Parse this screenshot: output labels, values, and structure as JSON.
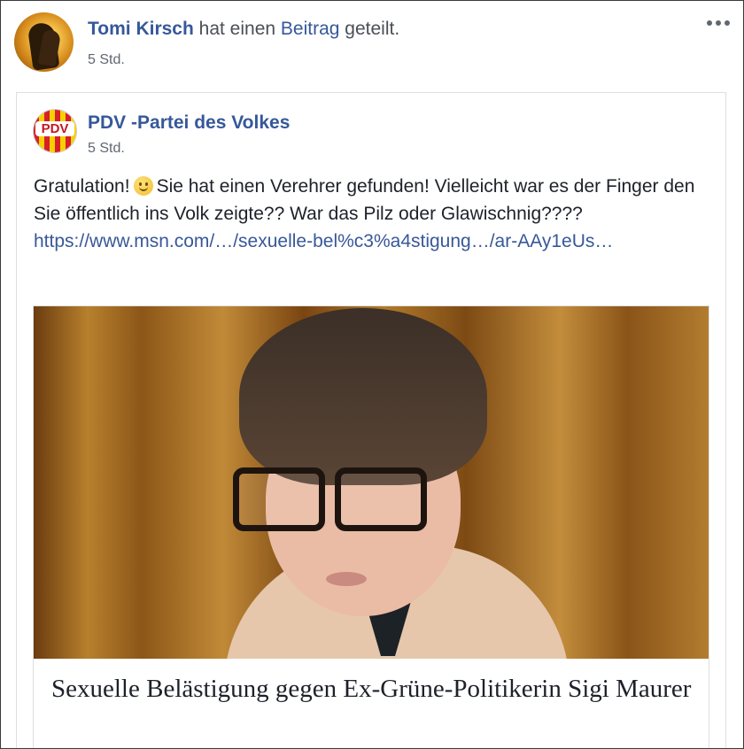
{
  "sharer": {
    "name": "Tomi Kirsch",
    "action_text": "hat einen",
    "action_link": "Beitrag",
    "action_end": "geteilt.",
    "time": "5 Std."
  },
  "shared_post": {
    "page_name": "PDV -Partei des Volkes",
    "page_logo_text": "PDV",
    "time": "5 Std.",
    "text_before_emoji": "Gratulation!",
    "emoji": "slightly-smiling-face",
    "text_after_emoji": "Sie hat einen Verehrer gefunden! Vielleicht war es der Finger den Sie öffentlich ins Volk zeigte?? War das Pilz oder Glawischnig????",
    "link_url": "https://www.msn.com/…/sexuelle-bel%c3%a4stigung…/ar-AAy1eUs…"
  },
  "link_preview": {
    "headline": "Sexuelle Belästigung gegen Ex-Grüne-Politikerin Sigi Maurer"
  },
  "icons": {
    "more": "more-options-icon"
  },
  "colors": {
    "link_blue": "#365899",
    "text": "#1d2129",
    "meta_gray": "#616770"
  }
}
